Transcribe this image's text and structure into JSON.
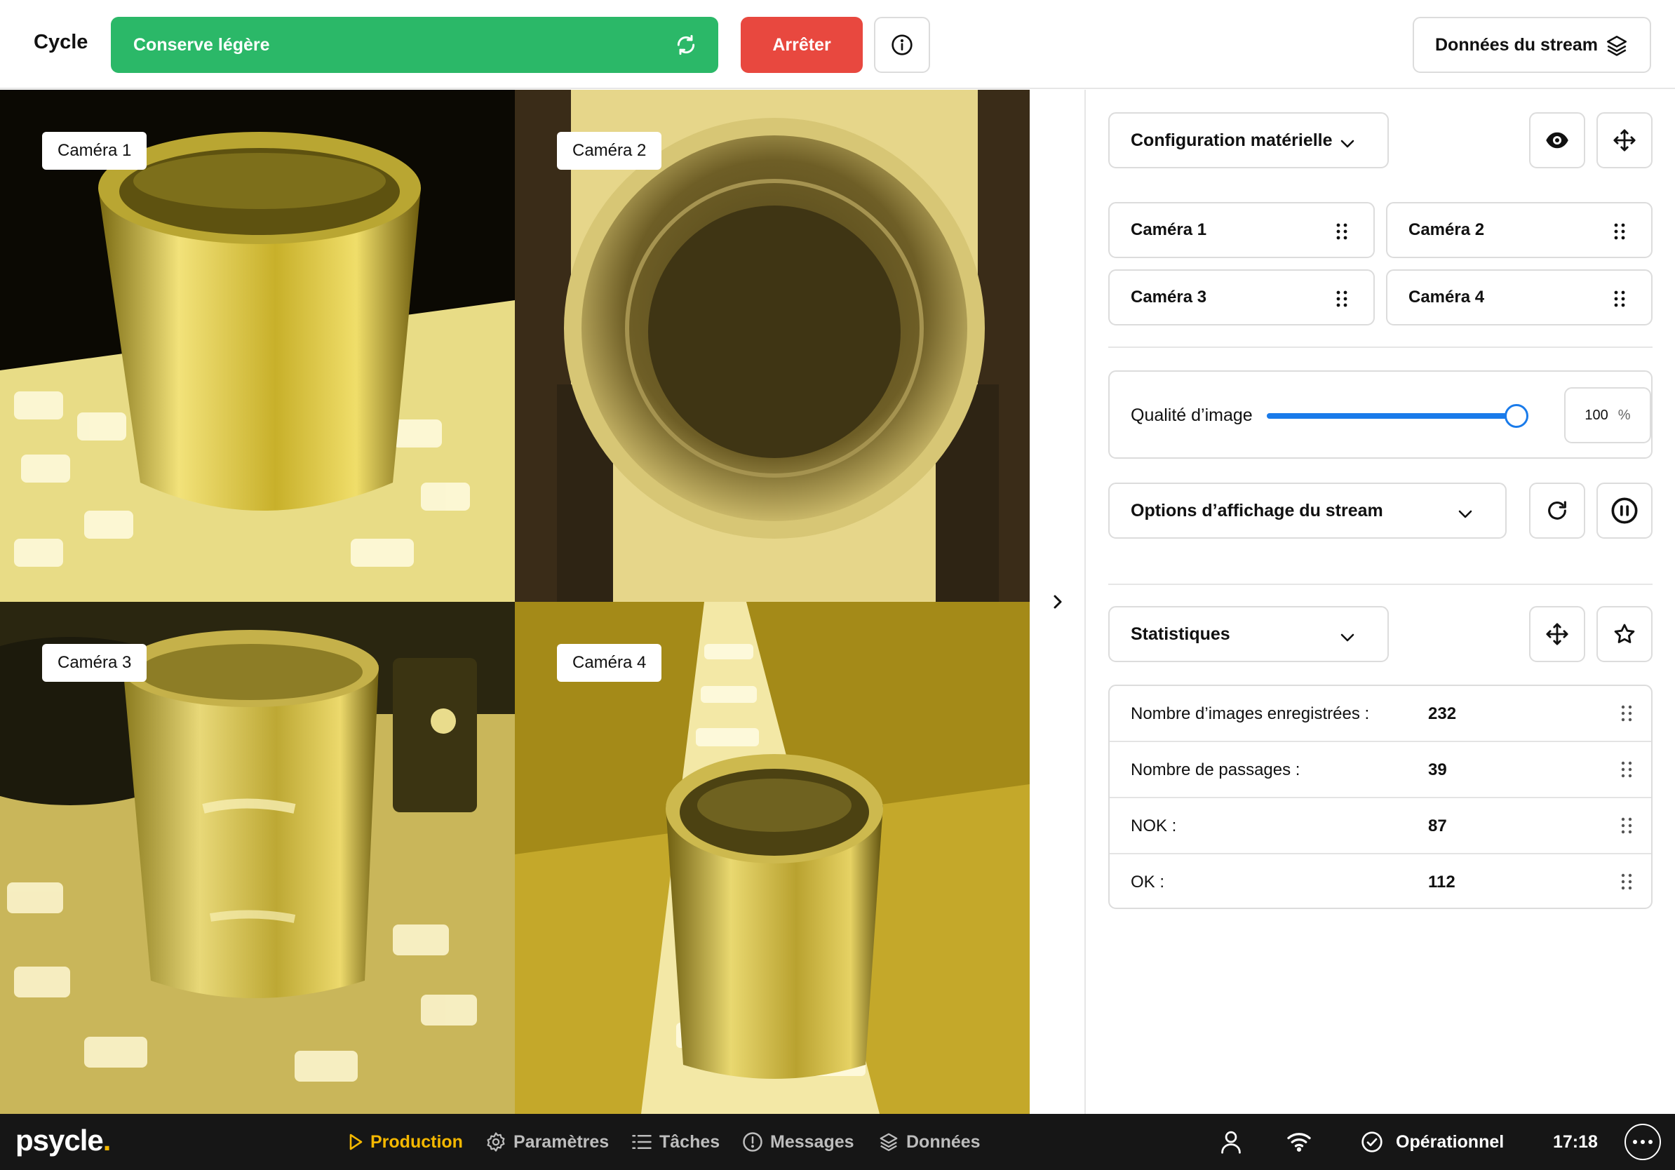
{
  "header": {
    "cycle_label": "Cycle",
    "cycle_value": "Conserve légère",
    "stop_label": "Arrêter",
    "stream_data_label": "Données du stream"
  },
  "cameras": [
    {
      "label": "Caméra 1"
    },
    {
      "label": "Caméra 2"
    },
    {
      "label": "Caméra 3"
    },
    {
      "label": "Caméra 4"
    }
  ],
  "panel": {
    "hardware_config_label": "Configuration matérielle",
    "camera_items": [
      "Caméra 1",
      "Caméra 2",
      "Caméra 3",
      "Caméra 4"
    ],
    "image_quality": {
      "label": "Qualité d’image",
      "value": "100",
      "unit": "%",
      "fraction": 1.0
    },
    "display_options_label": "Options d’affichage du stream",
    "statistics_label": "Statistiques",
    "stats": [
      {
        "label": "Nombre d’images enregistrées :",
        "value": "232"
      },
      {
        "label": "Nombre de passages :",
        "value": "39"
      },
      {
        "label": "NOK :",
        "value": "87"
      },
      {
        "label": "OK :",
        "value": "112"
      }
    ]
  },
  "bottombar": {
    "logo_text": "psycle",
    "logo_dot": ".",
    "nav": [
      {
        "label": "Production",
        "icon": "play-icon",
        "active": true
      },
      {
        "label": "Paramètres",
        "icon": "gear-icon",
        "active": false
      },
      {
        "label": "Tâches",
        "icon": "list-icon",
        "active": false
      },
      {
        "label": "Messages",
        "icon": "alert-circle-icon",
        "active": false
      },
      {
        "label": "Données",
        "icon": "layers-icon",
        "active": false
      }
    ],
    "status_label": "Opérationnel",
    "time": "17:18"
  },
  "colors": {
    "cycle_green": "#2bb868",
    "stop_red": "#e8483f",
    "slider_blue": "#1a7bea",
    "nav_active": "#f5b800",
    "bottombar_bg": "#161616"
  }
}
